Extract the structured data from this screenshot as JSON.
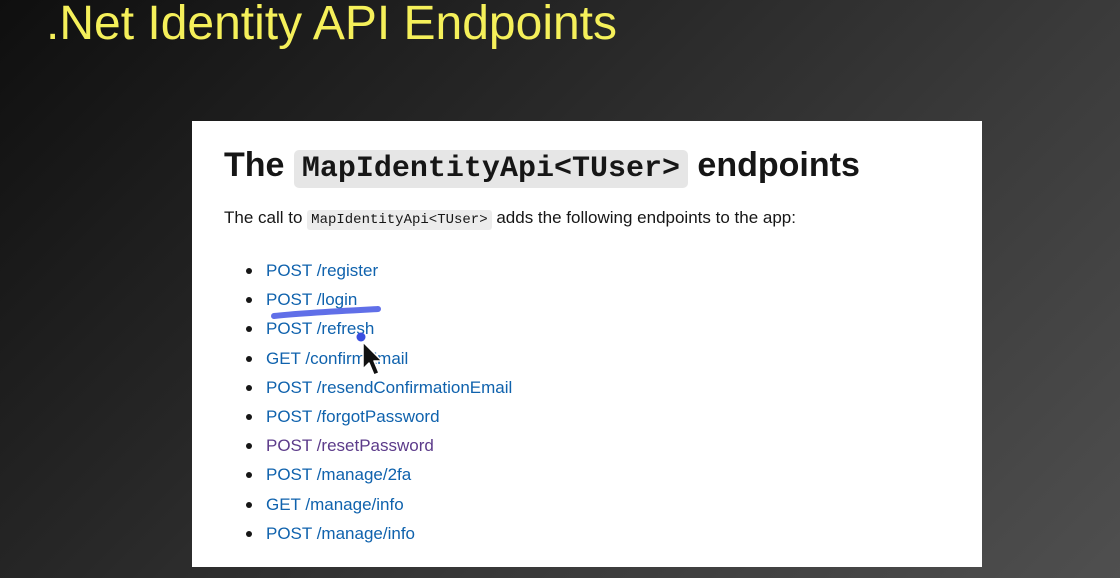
{
  "slide": {
    "title": ".Net Identity API Endpoints"
  },
  "doc": {
    "heading_prefix": "The",
    "heading_code": "MapIdentityApi<TUser>",
    "heading_suffix": "endpoints",
    "intro_prefix": "The call to",
    "intro_code": "MapIdentityApi<TUser>",
    "intro_suffix": "adds the following endpoints to the app:",
    "endpoints": [
      {
        "label": "POST /register"
      },
      {
        "label": "POST /login"
      },
      {
        "label": "POST /refresh"
      },
      {
        "label": "GET /confirmEmail"
      },
      {
        "label": "POST /resendConfirmationEmail"
      },
      {
        "label": "POST /forgotPassword"
      },
      {
        "label": "POST /resetPassword"
      },
      {
        "label": "POST /manage/2fa"
      },
      {
        "label": "GET /manage/info"
      },
      {
        "label": "POST /manage/info"
      }
    ]
  },
  "colors": {
    "title": "#f5f05a",
    "link": "#0f62ad",
    "visited_link": "#5c3b8a",
    "annotation": "#4f5fe6"
  },
  "icons": {
    "cursor": "mouse-pointer-icon",
    "pen_dot": "pen-dot-icon"
  }
}
